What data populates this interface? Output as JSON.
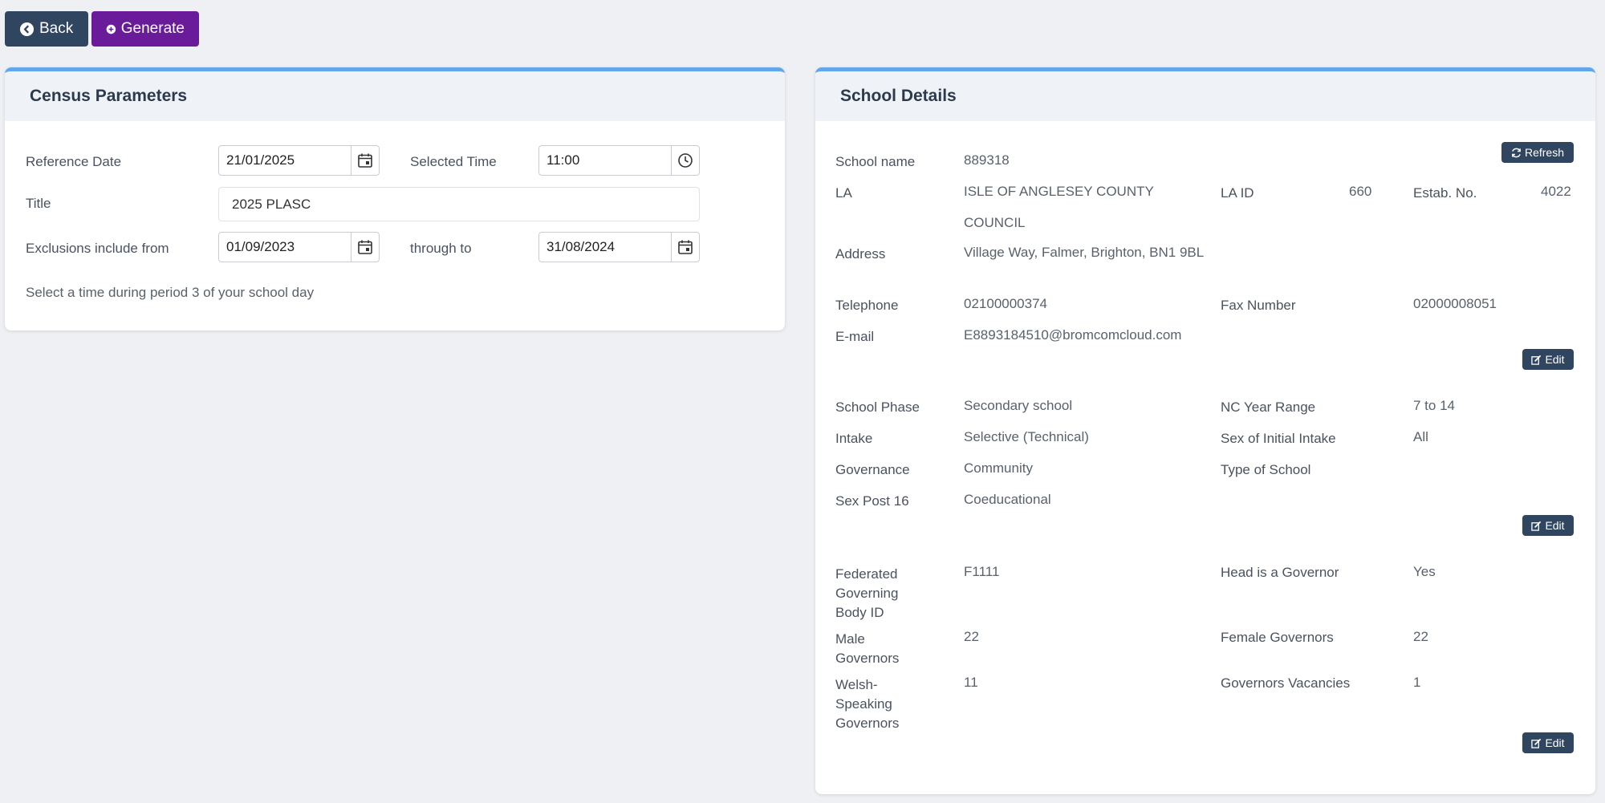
{
  "toolbar": {
    "back_label": "Back",
    "generate_label": "Generate"
  },
  "census": {
    "title": "Census Parameters",
    "reference_date_label": "Reference Date",
    "reference_date": "21/01/2025",
    "selected_time_label": "Selected Time",
    "selected_time": "11:00",
    "title_label": "Title",
    "title_value": "2025 PLASC",
    "exclusions_label": "Exclusions include from",
    "exclusions_from": "01/09/2023",
    "through_label": "through to",
    "exclusions_to": "31/08/2024",
    "hint": "Select a time during period 3 of your school day"
  },
  "school": {
    "title": "School Details",
    "refresh_label": "Refresh",
    "edit_label": "Edit",
    "name_label": "School name",
    "name": "889318",
    "la_label": "LA",
    "la_line1": "ISLE OF ANGLESEY COUNTY",
    "la_line2": "COUNCIL",
    "la_id_label": "LA ID",
    "la_id": "660",
    "estab_label": "Estab. No.",
    "estab": "4022",
    "address_label": "Address",
    "address": "Village Way, Falmer, Brighton, BN1 9BL",
    "telephone_label": "Telephone",
    "telephone": "02100000374",
    "fax_label": "Fax Number",
    "fax": "02000008051",
    "email_label": "E-mail",
    "email": "E8893184510@bromcomcloud.com",
    "phase_label": "School Phase",
    "phase": "Secondary school",
    "nc_label": "NC Year Range",
    "nc": "7 to 14",
    "intake_label": "Intake",
    "intake": "Selective (Technical)",
    "sex_intake_label": "Sex of Initial Intake",
    "sex_intake": "All",
    "governance_label": "Governance",
    "governance": "Community",
    "type_label": "Type of School",
    "type": "",
    "sex16_label": "Sex Post 16",
    "sex16": "Coeducational",
    "fed_label_1": "Federated",
    "fed_label_2": "Governing",
    "fed_label_3": "Body ID",
    "fed": "F1111",
    "head_gov_label": "Head is a Governor",
    "head_gov": "Yes",
    "male_label_1": "Male",
    "male_label_2": "Governors",
    "male": "22",
    "female_label": "Female Governors",
    "female": "22",
    "welsh_label_1": "Welsh-",
    "welsh_label_2": "Speaking",
    "welsh_label_3": "Governors",
    "welsh": "11",
    "vacancies_label": "Governors Vacancies",
    "vacancies": "1"
  }
}
